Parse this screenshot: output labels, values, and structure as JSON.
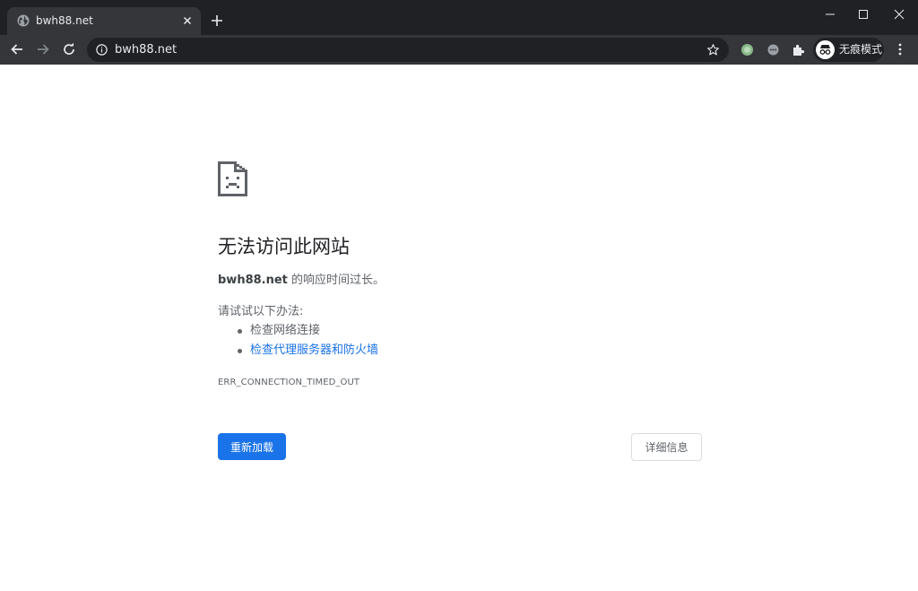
{
  "browser": {
    "tab": {
      "title": "bwh88.net",
      "favicon": "globe-icon"
    },
    "address_bar": {
      "url": "bwh88.net"
    },
    "extensions": {
      "badge_count": "1"
    },
    "profile": {
      "label": "无痕模式"
    },
    "colors": {
      "frame": "#202124",
      "toolbar": "#35363a",
      "text": "#e8eaed"
    }
  },
  "error_page": {
    "icon": "sad-document-icon",
    "heading": "无法访问此网站",
    "summary": {
      "host": "bwh88.net",
      "message": " 的响应时间过长。"
    },
    "suggestions_intro": "请试试以下办法:",
    "suggestions": [
      {
        "label": "检查网络连接"
      },
      {
        "label": "检查代理服务器和防火墙"
      }
    ],
    "error_code": "ERR_CONNECTION_TIMED_OUT",
    "reload_button": "重新加载",
    "details_button": "详细信息",
    "colors": {
      "primary": "#1a73e8",
      "text": "#5f6368",
      "heading": "#202124"
    }
  }
}
